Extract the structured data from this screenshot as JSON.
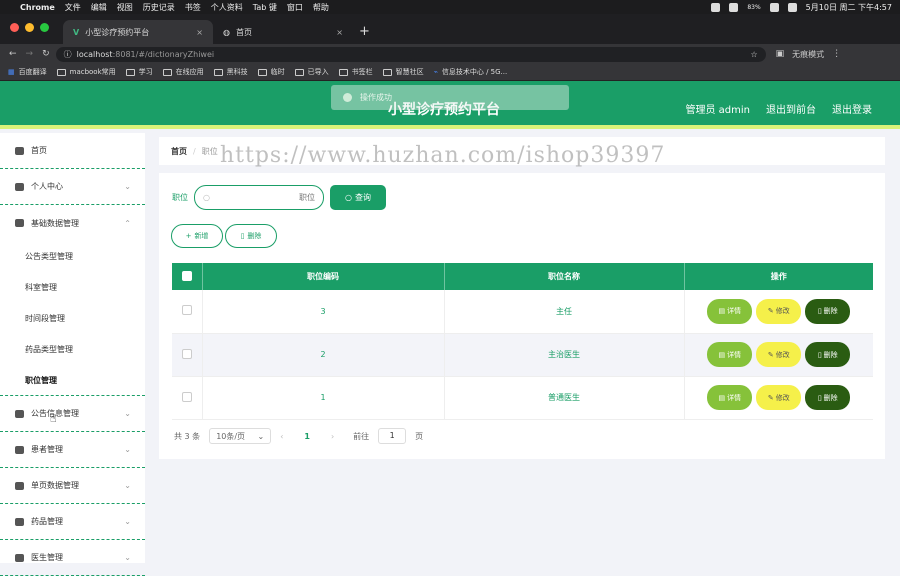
{
  "macos": {
    "apple": "",
    "app": "Chrome",
    "menus": [
      "文件",
      "编辑",
      "视图",
      "历史记录",
      "书签",
      "个人资料",
      "Tab 键",
      "窗口",
      "帮助"
    ],
    "status_pct": "83%",
    "datetime": "5月10日 周二 下午4:57"
  },
  "browser": {
    "tabs": [
      {
        "label": "小型诊疗预约平台",
        "close": "×"
      },
      {
        "label": "首页",
        "close": "×"
      }
    ],
    "new_tab": "+",
    "url_host": "localhost",
    "url_path": ":8081/#/dictionaryZhiwei",
    "profile": "无痕模式",
    "bookmarks": [
      "百度翻译",
      "macbook常用",
      "学习",
      "在线应用",
      "黑科技",
      "临时",
      "已导入",
      "书签栏",
      "智慧社区",
      "信息技术中心 / 5G..."
    ]
  },
  "app": {
    "title": "小型诊疗预约平台",
    "user_label": "管理员 admin",
    "back_front": "退出到前台",
    "logout": "退出登录",
    "toast": "操作成功"
  },
  "sidebar": {
    "items": [
      {
        "label": "首页",
        "icon": "home-icon"
      },
      {
        "label": "个人中心",
        "icon": "user-icon",
        "chevron": "⌄"
      },
      {
        "label": "基础数据管理",
        "icon": "sliders-icon",
        "chevron": "⌃"
      }
    ],
    "subitems": [
      "公告类型管理",
      "科室管理",
      "时间段管理",
      "药品类型管理",
      "职位管理"
    ],
    "items2": [
      {
        "label": "公告信息管理",
        "icon": "gauge-icon",
        "chevron": "⌄"
      },
      {
        "label": "患者管理",
        "icon": "person-icon",
        "chevron": "⌄"
      },
      {
        "label": "单页数据管理",
        "icon": "send-icon",
        "chevron": "⌄"
      },
      {
        "label": "药品管理",
        "icon": "chat-icon",
        "chevron": "⌄"
      },
      {
        "label": "医生管理",
        "icon": "doctor-icon",
        "chevron": "⌄"
      }
    ]
  },
  "breadcrumb": {
    "home": "首页",
    "sep": "/",
    "current": "职位"
  },
  "filter": {
    "label": "职位",
    "placeholder": "职位",
    "search_btn": "查询"
  },
  "actions": {
    "add": "新增",
    "delete": "删除"
  },
  "table": {
    "headers": [
      "职位编码",
      "职位名称",
      "操作"
    ],
    "rows": [
      {
        "code": "3",
        "name": "主任"
      },
      {
        "code": "2",
        "name": "主治医生"
      },
      {
        "code": "1",
        "name": "普通医生"
      }
    ],
    "row_actions": {
      "detail": "详情",
      "edit": "修改",
      "delete": "删除"
    }
  },
  "pagination": {
    "total": "共 3 条",
    "page_size": "10条/页",
    "prev": "‹",
    "current": "1",
    "next": "›",
    "goto_label": "前往",
    "goto_value": "1",
    "page_suffix": "页"
  },
  "watermark": "https://www.huzhan.com/ishop39397",
  "colors": {
    "primary": "#1a9e67",
    "accent_stripe": "#d9f27a",
    "detail": "#86c23a",
    "edit": "#f5f04a",
    "delete": "#2a5c12"
  }
}
